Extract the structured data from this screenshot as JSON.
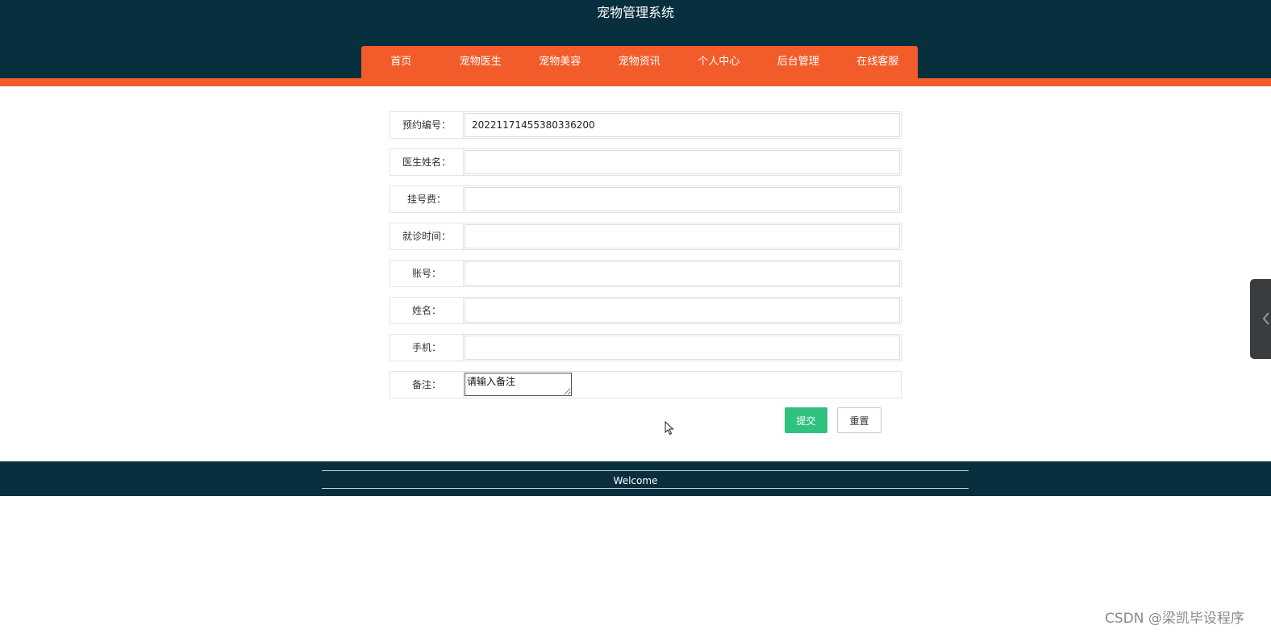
{
  "header": {
    "title": "宠物管理系统"
  },
  "nav": {
    "items": [
      {
        "label": "首页"
      },
      {
        "label": "宠物医生"
      },
      {
        "label": "宠物美容"
      },
      {
        "label": "宠物资讯"
      },
      {
        "label": "个人中心"
      },
      {
        "label": "后台管理"
      },
      {
        "label": "在线客服"
      }
    ]
  },
  "form": {
    "fields": [
      {
        "label": "预约编号：",
        "value": "20221171455380336200"
      },
      {
        "label": "医生姓名：",
        "value": ""
      },
      {
        "label": "挂号费：",
        "value": ""
      },
      {
        "label": "就诊时间：",
        "value": ""
      },
      {
        "label": "账号：",
        "value": ""
      },
      {
        "label": "姓名：",
        "value": ""
      },
      {
        "label": "手机：",
        "value": ""
      }
    ],
    "remark": {
      "label": "备注：",
      "placeholder": "请输入备注"
    },
    "submit_label": "提交",
    "reset_label": "重置"
  },
  "footer": {
    "text": "Welcome"
  },
  "side_tab": {
    "icon": "chevron-left-icon"
  },
  "watermark": {
    "text": "CSDN @梁凯毕设程序"
  },
  "colors": {
    "header_bg": "#082f3e",
    "accent_orange": "#f25c2a",
    "submit_green": "#2ec27e"
  }
}
